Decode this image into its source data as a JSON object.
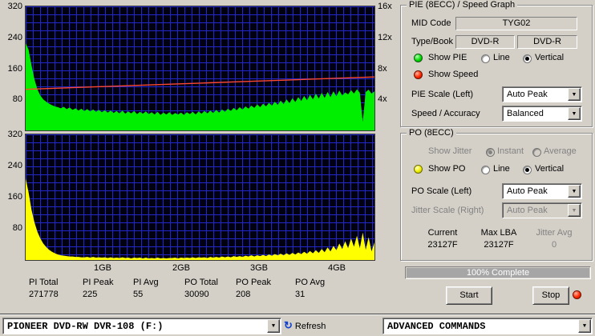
{
  "axes": {
    "pie_y": [
      "320",
      "240",
      "160",
      "80"
    ],
    "po_y": [
      "320",
      "240",
      "160",
      "80"
    ],
    "speed": [
      "16x",
      "12x",
      "8x",
      "4x"
    ],
    "x": [
      "1GB",
      "2GB",
      "3GB",
      "4GB"
    ]
  },
  "stats": [
    {
      "label": "PI Total",
      "value": "271778"
    },
    {
      "label": "PI Peak",
      "value": "225"
    },
    {
      "label": "PI Avg",
      "value": "55"
    },
    {
      "label": "PO Total",
      "value": "30090"
    },
    {
      "label": "PO Peak",
      "value": "208"
    },
    {
      "label": "PO Avg",
      "value": "31"
    }
  ],
  "pie_panel": {
    "title": "PIE (8ECC) / Speed Graph",
    "mid_code_label": "MID Code",
    "mid_code": "TYG02",
    "type_book_label": "Type/Book",
    "type_value": "DVD-R",
    "book_value": "DVD-R",
    "show_pie": "Show PIE",
    "show_speed": "Show Speed",
    "line": "Line",
    "vertical": "Vertical",
    "pie_scale_label": "PIE Scale (Left)",
    "pie_scale_value": "Auto Peak",
    "speed_accuracy_label": "Speed / Accuracy",
    "speed_accuracy_value": "Balanced"
  },
  "po_panel": {
    "title": "PO (8ECC)",
    "show_jitter": "Show Jitter",
    "instant": "Instant",
    "average": "Average",
    "show_po": "Show PO",
    "line": "Line",
    "vertical": "Vertical",
    "po_scale_label": "PO Scale (Left)",
    "po_scale_value": "Auto Peak",
    "jitter_scale_label": "Jitter Scale (Right)",
    "jitter_scale_value": "Auto Peak",
    "current_label": "Current",
    "current_value": "23127F",
    "max_lba_label": "Max LBA",
    "max_lba_value": "23127F",
    "jitter_avg_label": "Jitter Avg",
    "jitter_avg_value": "0"
  },
  "progress": {
    "text": "100% Complete",
    "percent": 100
  },
  "buttons": {
    "start": "Start",
    "stop": "Stop"
  },
  "bottom_bar": {
    "drive": "PIONEER DVD-RW  DVR-108  (F:)",
    "refresh": "Refresh",
    "commands": "ADVANCED COMMANDS"
  },
  "chart_data": [
    {
      "type": "area",
      "name": "PIE (8ECC) errors",
      "color": "#00ee00",
      "ylim": [
        0,
        320
      ],
      "x_range_gb": [
        0,
        4.49
      ],
      "values": [
        225,
        208,
        168,
        132,
        106,
        90,
        80,
        74,
        69,
        65,
        62,
        60,
        57,
        61,
        55,
        59,
        53,
        57,
        51,
        56,
        50,
        55,
        49,
        54,
        48,
        53,
        47,
        52,
        46,
        51,
        45,
        50,
        44,
        51,
        43,
        49,
        44,
        50,
        42,
        48,
        43,
        49,
        42,
        47,
        41,
        48,
        40,
        46,
        41,
        47,
        40,
        45,
        41,
        46,
        40,
        47,
        42,
        48,
        41,
        49,
        43,
        50,
        44,
        51,
        45,
        53,
        46,
        54,
        48,
        56,
        50,
        58,
        52,
        60,
        54,
        62,
        56,
        64,
        58,
        67,
        60,
        69,
        62,
        71,
        64,
        74,
        66,
        77,
        68,
        80,
        70,
        83,
        73,
        86,
        76,
        89,
        78,
        92,
        80,
        95,
        82,
        97,
        84,
        99,
        86,
        101,
        88,
        103,
        90,
        98,
        93,
        104,
        95,
        106,
        97,
        22,
        99,
        105,
        95,
        101
      ]
    },
    {
      "type": "line",
      "name": "Read Speed",
      "color": "#ff4830",
      "ylim": [
        0,
        16
      ],
      "unit": "x",
      "values": [
        5.3,
        5.5,
        5.7,
        5.9,
        6.1,
        6.3,
        6.5,
        6.7,
        6.9
      ]
    },
    {
      "type": "area",
      "name": "PO (8ECC) errors",
      "color": "#ffff00",
      "ylim": [
        0,
        320
      ],
      "x_range_gb": [
        0,
        4.49
      ],
      "values": [
        208,
        172,
        128,
        96,
        72,
        55,
        42,
        33,
        26,
        21,
        17,
        14,
        12,
        11,
        10,
        9,
        9,
        8,
        8,
        7,
        7,
        8,
        6,
        8,
        6,
        7,
        6,
        7,
        5,
        7,
        5,
        6,
        5,
        7,
        5,
        6,
        4,
        6,
        5,
        6,
        4,
        6,
        4,
        5,
        4,
        6,
        4,
        5,
        4,
        5,
        5,
        6,
        4,
        6,
        5,
        6,
        5,
        7,
        5,
        7,
        6,
        7,
        5,
        8,
        6,
        8,
        6,
        9,
        7,
        9,
        7,
        10,
        8,
        10,
        8,
        11,
        9,
        12,
        9,
        12,
        10,
        13,
        10,
        14,
        11,
        15,
        12,
        16,
        12,
        17,
        13,
        18,
        14,
        19,
        15,
        21,
        16,
        23,
        17,
        25,
        18,
        28,
        20,
        32,
        22,
        36,
        25,
        42,
        28,
        48,
        30,
        55,
        34,
        62,
        30,
        70,
        26,
        58,
        22,
        45
      ]
    }
  ]
}
